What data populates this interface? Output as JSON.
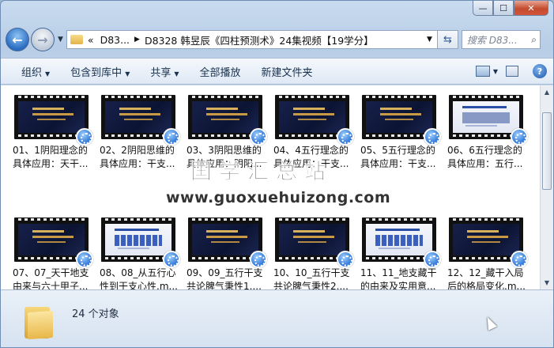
{
  "window": {
    "title": "",
    "caption": {
      "minimize": "—",
      "maximize": "☐",
      "close": "✕"
    }
  },
  "address": {
    "prefix": "«",
    "crumbs": [
      "D83...",
      "D8328 韩昱辰《四柱预测术》24集视频【19学分】"
    ]
  },
  "search": {
    "placeholder": "搜索 D83..."
  },
  "toolbar": {
    "organize": "组织",
    "include_library": "包含到库中",
    "share": "共享",
    "play_all": "全部播放",
    "new_folder": "新建文件夹"
  },
  "files": [
    {
      "label": "01、1阴阳理念的具体应用：天干...",
      "style": "dark"
    },
    {
      "label": "02、2阴阳思维的具体应用：干支...",
      "style": "dark"
    },
    {
      "label": "03、3阴阳思维的具体应用：阴阳...",
      "style": "dark"
    },
    {
      "label": "04、4五行理念的具体应用：干支...",
      "style": "dark"
    },
    {
      "label": "05、5五行理念的具体应用：干支...",
      "style": "dark"
    },
    {
      "label": "06、6五行理念的具体应用：五行...",
      "style": "light"
    },
    {
      "label": "07、07_天干地支由来与六十甲子...",
      "style": "dark"
    },
    {
      "label": "08、08_从五行心性到干支心性.m...",
      "style": "table"
    },
    {
      "label": "09、09_五行干支共论脾气秉性1....",
      "style": "dark"
    },
    {
      "label": "10、10_五行干支共论脾气秉性2....",
      "style": "dark"
    },
    {
      "label": "11、11_地支藏干的由来及实用意...",
      "style": "table"
    },
    {
      "label": "12、12_藏干入局后的格局变化.m...",
      "style": "dark"
    }
  ],
  "watermark": {
    "text": "国学汇总站",
    "url": "www.guoxuehuizong.com"
  },
  "status": {
    "count": "24 个对象"
  }
}
